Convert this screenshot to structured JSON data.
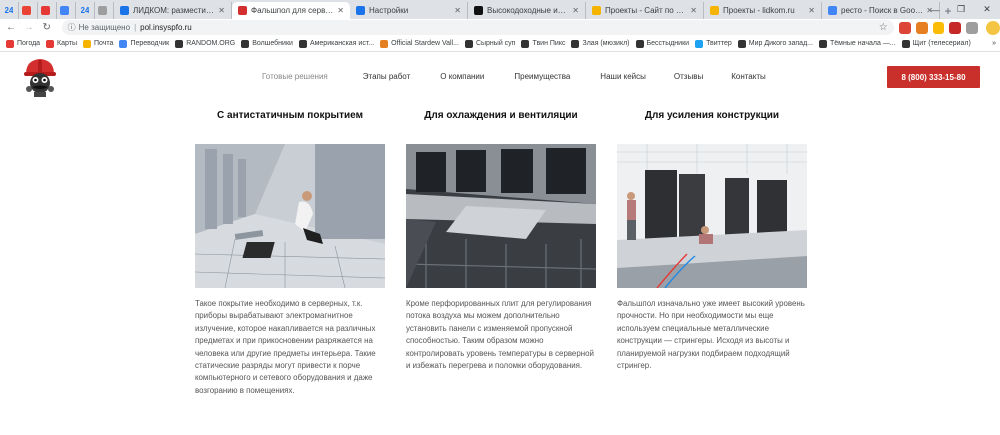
{
  "browser": {
    "tabs": [
      {
        "label": "24",
        "pinned": true,
        "color": "#1a73e8"
      },
      {
        "label": "",
        "pinned": true,
        "color": "#ea4335"
      },
      {
        "label": "",
        "pinned": true,
        "color": "#e53935"
      },
      {
        "label": "",
        "pinned": true,
        "color": "#4285f4"
      },
      {
        "label": "24",
        "pinned": true,
        "color": "#1a73e8"
      },
      {
        "label": "",
        "pinned": true,
        "color": "#9e9e9e"
      },
      {
        "label": "ЛИДКОМ: разместить пре",
        "color": "#1a73e8"
      },
      {
        "label": "Фальшпол для серверных",
        "color": "#d32f2f",
        "active": true
      },
      {
        "label": "Настройки",
        "color": "#1a73e8"
      },
      {
        "label": "Высокодоходные инвести",
        "color": "#111111"
      },
      {
        "label": "Проекты - Сайт по умол",
        "color": "#f4b400"
      },
      {
        "label": "Проекты - lidkom.ru",
        "color": "#f4b400"
      },
      {
        "label": "ресто - Поиск в Google",
        "color": "#4285f4"
      }
    ],
    "new_tab": "+",
    "window_controls": [
      "—",
      "❐",
      "✕"
    ],
    "address": {
      "security": "Не защищено",
      "url": "pol.insyspfo.ru"
    },
    "bookmarks": [
      {
        "label": "Погода",
        "color": "#e53935"
      },
      {
        "label": "Карты",
        "color": "#e53935"
      },
      {
        "label": "Почта",
        "color": "#f4b400"
      },
      {
        "label": "Переводчик",
        "color": "#4285f4"
      },
      {
        "label": "RANDOM.ORG",
        "color": "#333333"
      },
      {
        "label": "Волшебники",
        "color": "#333333"
      },
      {
        "label": "Американская ист...",
        "color": "#333333"
      },
      {
        "label": "Official Stardew Vall...",
        "color": "#e67e22"
      },
      {
        "label": "Сырный суп",
        "color": "#333333"
      },
      {
        "label": "Твин Пикс",
        "color": "#333333"
      },
      {
        "label": "Злая (мюзикл)",
        "color": "#333333"
      },
      {
        "label": "Бесстыдники",
        "color": "#333333"
      },
      {
        "label": "Твиттер",
        "color": "#1da1f2"
      },
      {
        "label": "Мир Дикого запад...",
        "color": "#333333"
      },
      {
        "label": "Тёмные начала —...",
        "color": "#333333"
      },
      {
        "label": "Щит (телесериал)",
        "color": "#333333"
      }
    ],
    "bookmarks_more": "»"
  },
  "site": {
    "nav": [
      "Готовые решения",
      "Этапы работ",
      "О компании",
      "Преимущества",
      "Наши кейсы",
      "Отзывы",
      "Контакты"
    ],
    "phone": "8 (800) 333-15-80",
    "accent": "#c9302c"
  },
  "features": [
    {
      "title": "С антистатичным покрытием",
      "text": "Такое покрытие необходимо в серверных, т.к. приборы вырабатывают электромагнитное излучение, которое накапливается на различных предметах и при прикосновении разряжается на человека или другие предметы интерьера. Такие статические разряды могут привести к порче компьютерного и сетевого оборудования и даже возгоранию в помещениях."
    },
    {
      "title": "Для охлаждения и вентиляции",
      "text": "Кроме перфорированных плит для регулирования потока воздуха мы можем дополнительно установить панели с изменяемой пропускной способностью. Таким образом можно контролировать уровень температуры в серверной и избежать перегрева и поломки оборудования."
    },
    {
      "title": "Для усиления конструкции",
      "text": "Фальшпол изначально уже имеет высокий уровень прочности. Но при необходимости мы еще используем специальные металлические конструкции — стрингеры. Исходя из высоты и планируемой нагрузки подбираем подходящий стрингер."
    }
  ]
}
